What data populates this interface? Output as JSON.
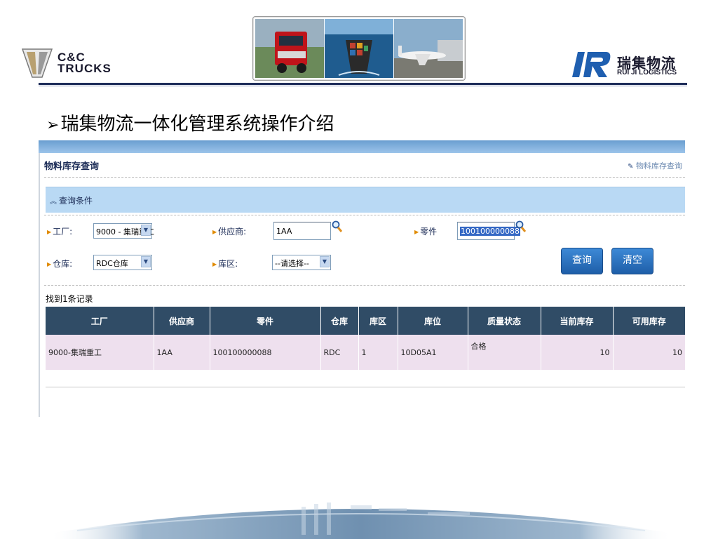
{
  "header": {
    "left_logo": {
      "line1": "C&C",
      "line2": "TRUCKS"
    },
    "right_logo": {
      "cn": "瑞集物流",
      "en": "RUI JI LOGISTICS"
    }
  },
  "slide": {
    "title": "瑞集物流一体化管理系统操作介绍"
  },
  "app": {
    "page_title": "物料库存查询",
    "breadcrumb": "物料库存查询",
    "query_section": "查询条件",
    "fields": {
      "factory": {
        "label": "工厂:",
        "value": "9000 - 集瑞重工"
      },
      "supplier": {
        "label": "供应商:",
        "value": "1AA"
      },
      "part": {
        "label": "零件",
        "value": "100100000088"
      },
      "warehouse": {
        "label": "仓库:",
        "value": "RDC仓库"
      },
      "zone": {
        "label": "库区:",
        "value": "--请选择--"
      }
    },
    "buttons": {
      "search": "查询",
      "clear": "清空"
    },
    "result_count": "找到1条记录",
    "table": {
      "columns": [
        "工厂",
        "供应商",
        "零件",
        "仓库",
        "库区",
        "库位",
        "质量状态",
        "当前库存",
        "可用库存"
      ],
      "rows": [
        [
          "9000-集瑞重工",
          "1AA",
          "100100000088",
          "RDC",
          "1",
          "10D05A1",
          "合格",
          "10",
          "10"
        ]
      ]
    }
  },
  "colors": {
    "table_header": "#304c66",
    "row_bg": "#eee0ee",
    "query_bar": "#b9d9f4",
    "button": "#2a6fbe"
  }
}
